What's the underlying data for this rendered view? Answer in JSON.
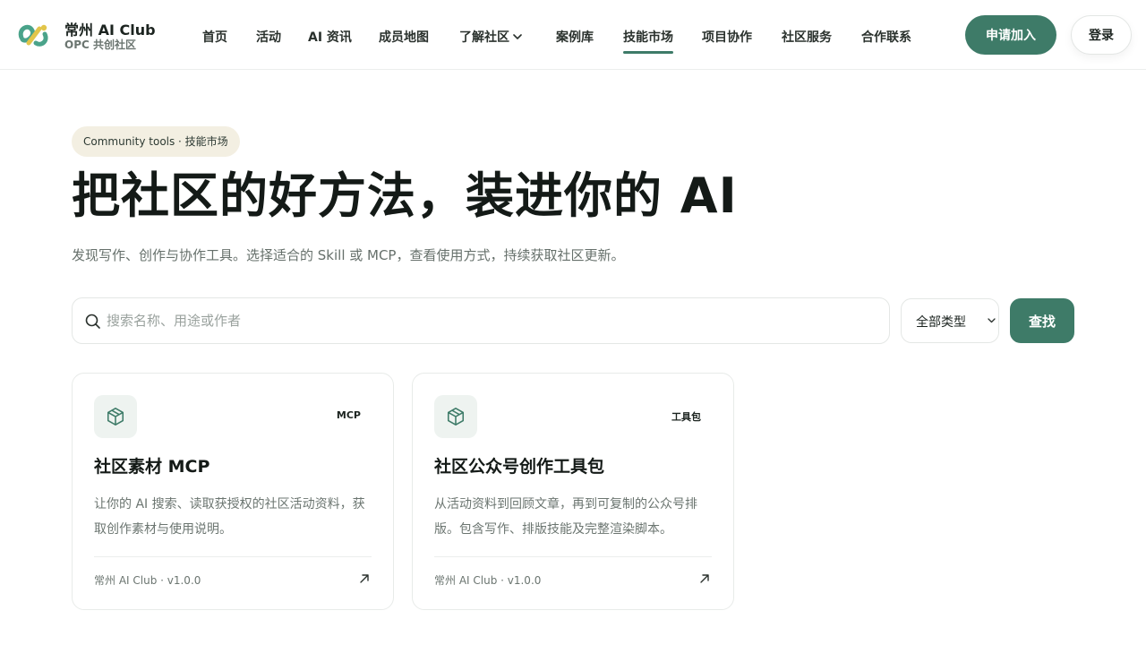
{
  "brand": {
    "name": "常州 AI Club",
    "subtitle": "OPC 共创社区",
    "logo_icon": "club-logo-icon",
    "colors": {
      "green": "#4aa38a",
      "yellow": "#e2c54a"
    }
  },
  "nav": {
    "items": [
      {
        "label": "首页"
      },
      {
        "label": "活动"
      },
      {
        "label": "AI 资讯"
      },
      {
        "label": "成员地图"
      },
      {
        "label": "了解社区",
        "icon": "chevron-down-icon"
      },
      {
        "label": "案例库"
      },
      {
        "label": "技能市场",
        "active": true
      },
      {
        "label": "项目协作"
      },
      {
        "label": "社区服务"
      },
      {
        "label": "合作联系"
      }
    ],
    "join_label": "申请加入",
    "login_label": "登录"
  },
  "hero": {
    "pill": "Community tools · 技能市场",
    "title": "把社区的好方法，装进你的 AI",
    "description": "发现写作、创作与协作工具。选择适合的 Skill 或 MCP，查看使用方式，持续获取社区更新。"
  },
  "search": {
    "placeholder": "搜索名称、用途或作者",
    "value": "",
    "type_selected": "全部类型",
    "button_label": "查找",
    "icon": "search-icon"
  },
  "cards": [
    {
      "badge": "MCP",
      "title": "社区素材 MCP",
      "description": "让你的 AI 搜索、读取获授权的社区活动资料，获取创作素材与使用说明。",
      "meta": "常州 AI Club · v1.0.0",
      "icon": "package-icon"
    },
    {
      "badge": "工具包",
      "title": "社区公众号创作工具包",
      "description": "从活动资料到回顾文章，再到可复制的公众号排版。包含写作、排版技能及完整渲染脚本。",
      "meta": "常州 AI Club · v1.0.0",
      "icon": "package-icon"
    }
  ],
  "theme": {
    "accent": "#3e7b68",
    "pill_bg": "#f3efe2"
  }
}
